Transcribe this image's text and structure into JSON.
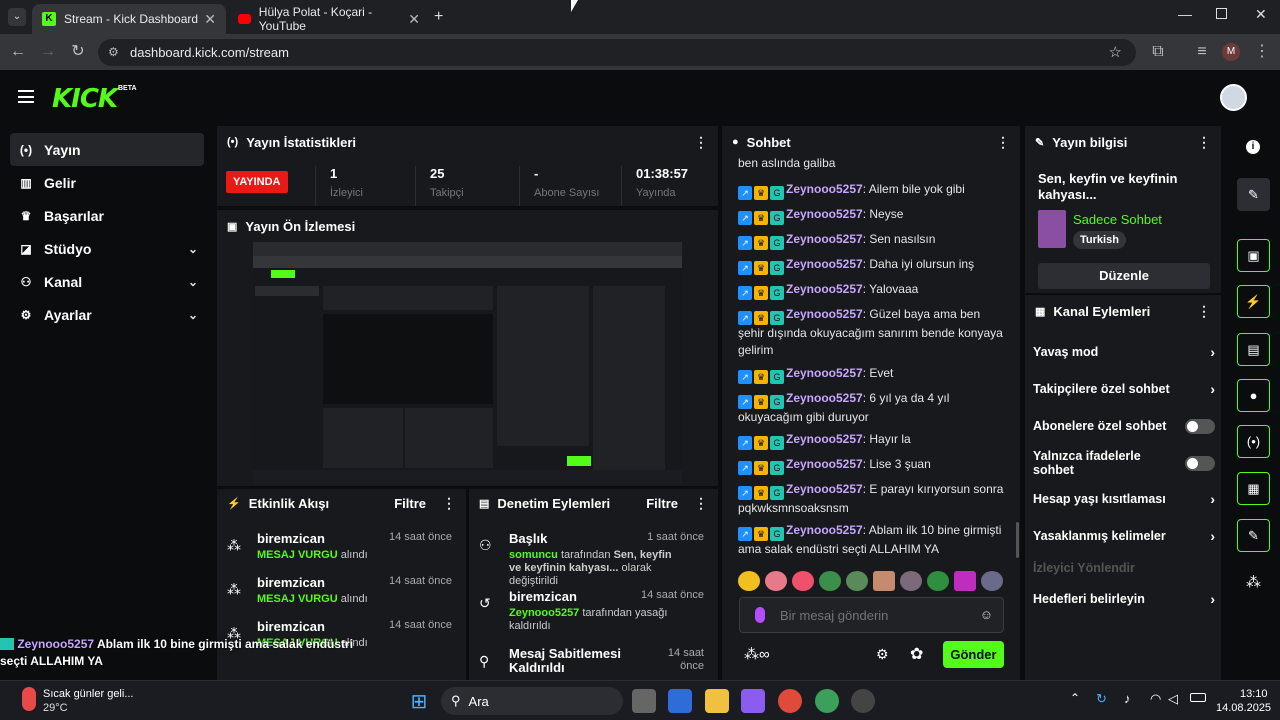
{
  "browser": {
    "tabs": [
      {
        "label": "Stream - Kick Dashboard"
      },
      {
        "label": "Hülya Polat - Koçari - YouTube"
      }
    ],
    "url": "dashboard.kick.com/stream",
    "profile_letter": "M"
  },
  "app": {
    "logo": "KICK",
    "logo_badge": "BETA",
    "accent": "#53fc18"
  },
  "sidebar": {
    "items": [
      {
        "label": "Yayın",
        "icon": "broadcast-icon"
      },
      {
        "label": "Gelir",
        "icon": "chart-icon"
      },
      {
        "label": "Başarılar",
        "icon": "trophy-icon"
      },
      {
        "label": "Stüdyo",
        "icon": "studio-icon"
      },
      {
        "label": "Kanal",
        "icon": "users-icon"
      },
      {
        "label": "Ayarlar",
        "icon": "gear-icon"
      }
    ]
  },
  "stats": {
    "title": "Yayın İstatistikleri",
    "status": "YAYINDA",
    "viewers": "1",
    "viewers_label": "İzleyici",
    "followers": "25",
    "followers_label": "Takipçi",
    "subs": "-",
    "subs_label": "Abone Sayısı",
    "duration": "01:38:57",
    "duration_label": "Yayında"
  },
  "preview": {
    "title": "Yayın Ön İzlemesi"
  },
  "activity": {
    "title": "Etkinlik Akışı",
    "filter": "Filtre",
    "items": [
      {
        "name": "biremzican",
        "highlight": "MESAJ VURGU",
        "action": "alındı",
        "time": "14 saat önce"
      },
      {
        "name": "biremzican",
        "highlight": "MESAJ VURGU",
        "action": "alındı",
        "time": "14 saat önce"
      },
      {
        "name": "biremzican",
        "highlight": "MESAJ VURGU",
        "action": "alındı",
        "time": "14 saat önce"
      }
    ]
  },
  "moderation": {
    "title": "Denetim Eylemleri",
    "filter": "Filtre",
    "items": [
      {
        "name": "Başlık",
        "actor": "somuncu",
        "mid": "tarafından",
        "detail": "Sen, keyfin ve keyfinin kahyası...",
        "tail": "olarak değiştirildi",
        "time": "1 saat önce"
      },
      {
        "name": "biremzican",
        "actor": "Zeynooo5257",
        "mid": "tarafından yasağı kaldırıldı",
        "time": "14 saat önce"
      },
      {
        "name": "Mesaj Sabitlemesi Kaldırıldı",
        "time": "14 saat önce"
      }
    ]
  },
  "chat": {
    "title": "Sohbet",
    "top_text": "ben aslında galiba",
    "messages": [
      {
        "user": "Zeynooo5257",
        "text": "Ailem bile yok gibi"
      },
      {
        "user": "Zeynooo5257",
        "text": "Neyse"
      },
      {
        "user": "Zeynooo5257",
        "text": "Sen nasılsın"
      },
      {
        "user": "Zeynooo5257",
        "text": "Daha iyi olursun inş"
      },
      {
        "user": "Zeynooo5257",
        "text": "Yalovaaa"
      },
      {
        "user": "Zeynooo5257",
        "text": "Güzel baya ama ben şehir dışında okuyacağım sanırım bende konyaya gelirim"
      },
      {
        "user": "Zeynooo5257",
        "text": "Evet"
      },
      {
        "user": "Zeynooo5257",
        "text": "6 yıl ya da 4 yıl okuyacağım gibi duruyor"
      },
      {
        "user": "Zeynooo5257",
        "text": "Hayır la"
      },
      {
        "user": "Zeynooo5257",
        "text": "Lise 3 şuan"
      },
      {
        "user": "Zeynooo5257",
        "text": "E parayı kırıyorsun sonra pqkwksmnsoaksnsm"
      },
      {
        "user": "Zeynooo5257",
        "text": "Ablam ilk 10 bine girmişti ama salak endüstri seçti ALLAHIM YA"
      }
    ],
    "placeholder": "Bir mesaj gönderin",
    "send": "Gönder"
  },
  "stream_info": {
    "title": "Yayın bilgisi",
    "stream_title": "Sen, keyfin ve keyfinin kahyası...",
    "category": "Sadece Sohbet",
    "tag": "Turkish",
    "edit": "Düzenle"
  },
  "channel_actions": {
    "title": "Kanal Eylemleri",
    "items": [
      {
        "label": "Yavaş mod",
        "kind": "chevron"
      },
      {
        "label": "Takipçilere özel sohbet",
        "kind": "chevron"
      },
      {
        "label": "Abonelere özel sohbet",
        "kind": "toggle"
      },
      {
        "label": "Yalnızca ifadelerle sohbet",
        "kind": "toggle"
      },
      {
        "label": "Hesap yaşı kısıtlaması",
        "kind": "chevron"
      },
      {
        "label": "Yasaklanmış kelimeler",
        "kind": "chevron"
      },
      {
        "label": "İzleyici Yönlendir",
        "kind": "disabled"
      },
      {
        "label": "Hedefleri belirleyin",
        "kind": "chevron"
      }
    ]
  },
  "overlay": {
    "user": "Zeynooo5257",
    "text": "Ablam ilk 10 bine girmişti ama salak endüstri seçti ALLAHIM YA"
  },
  "taskbar": {
    "weather_text": "Sıcak günler geli...",
    "temp": "29°C",
    "search": "Ara",
    "time": "13:10",
    "date": "14.08.2025"
  }
}
